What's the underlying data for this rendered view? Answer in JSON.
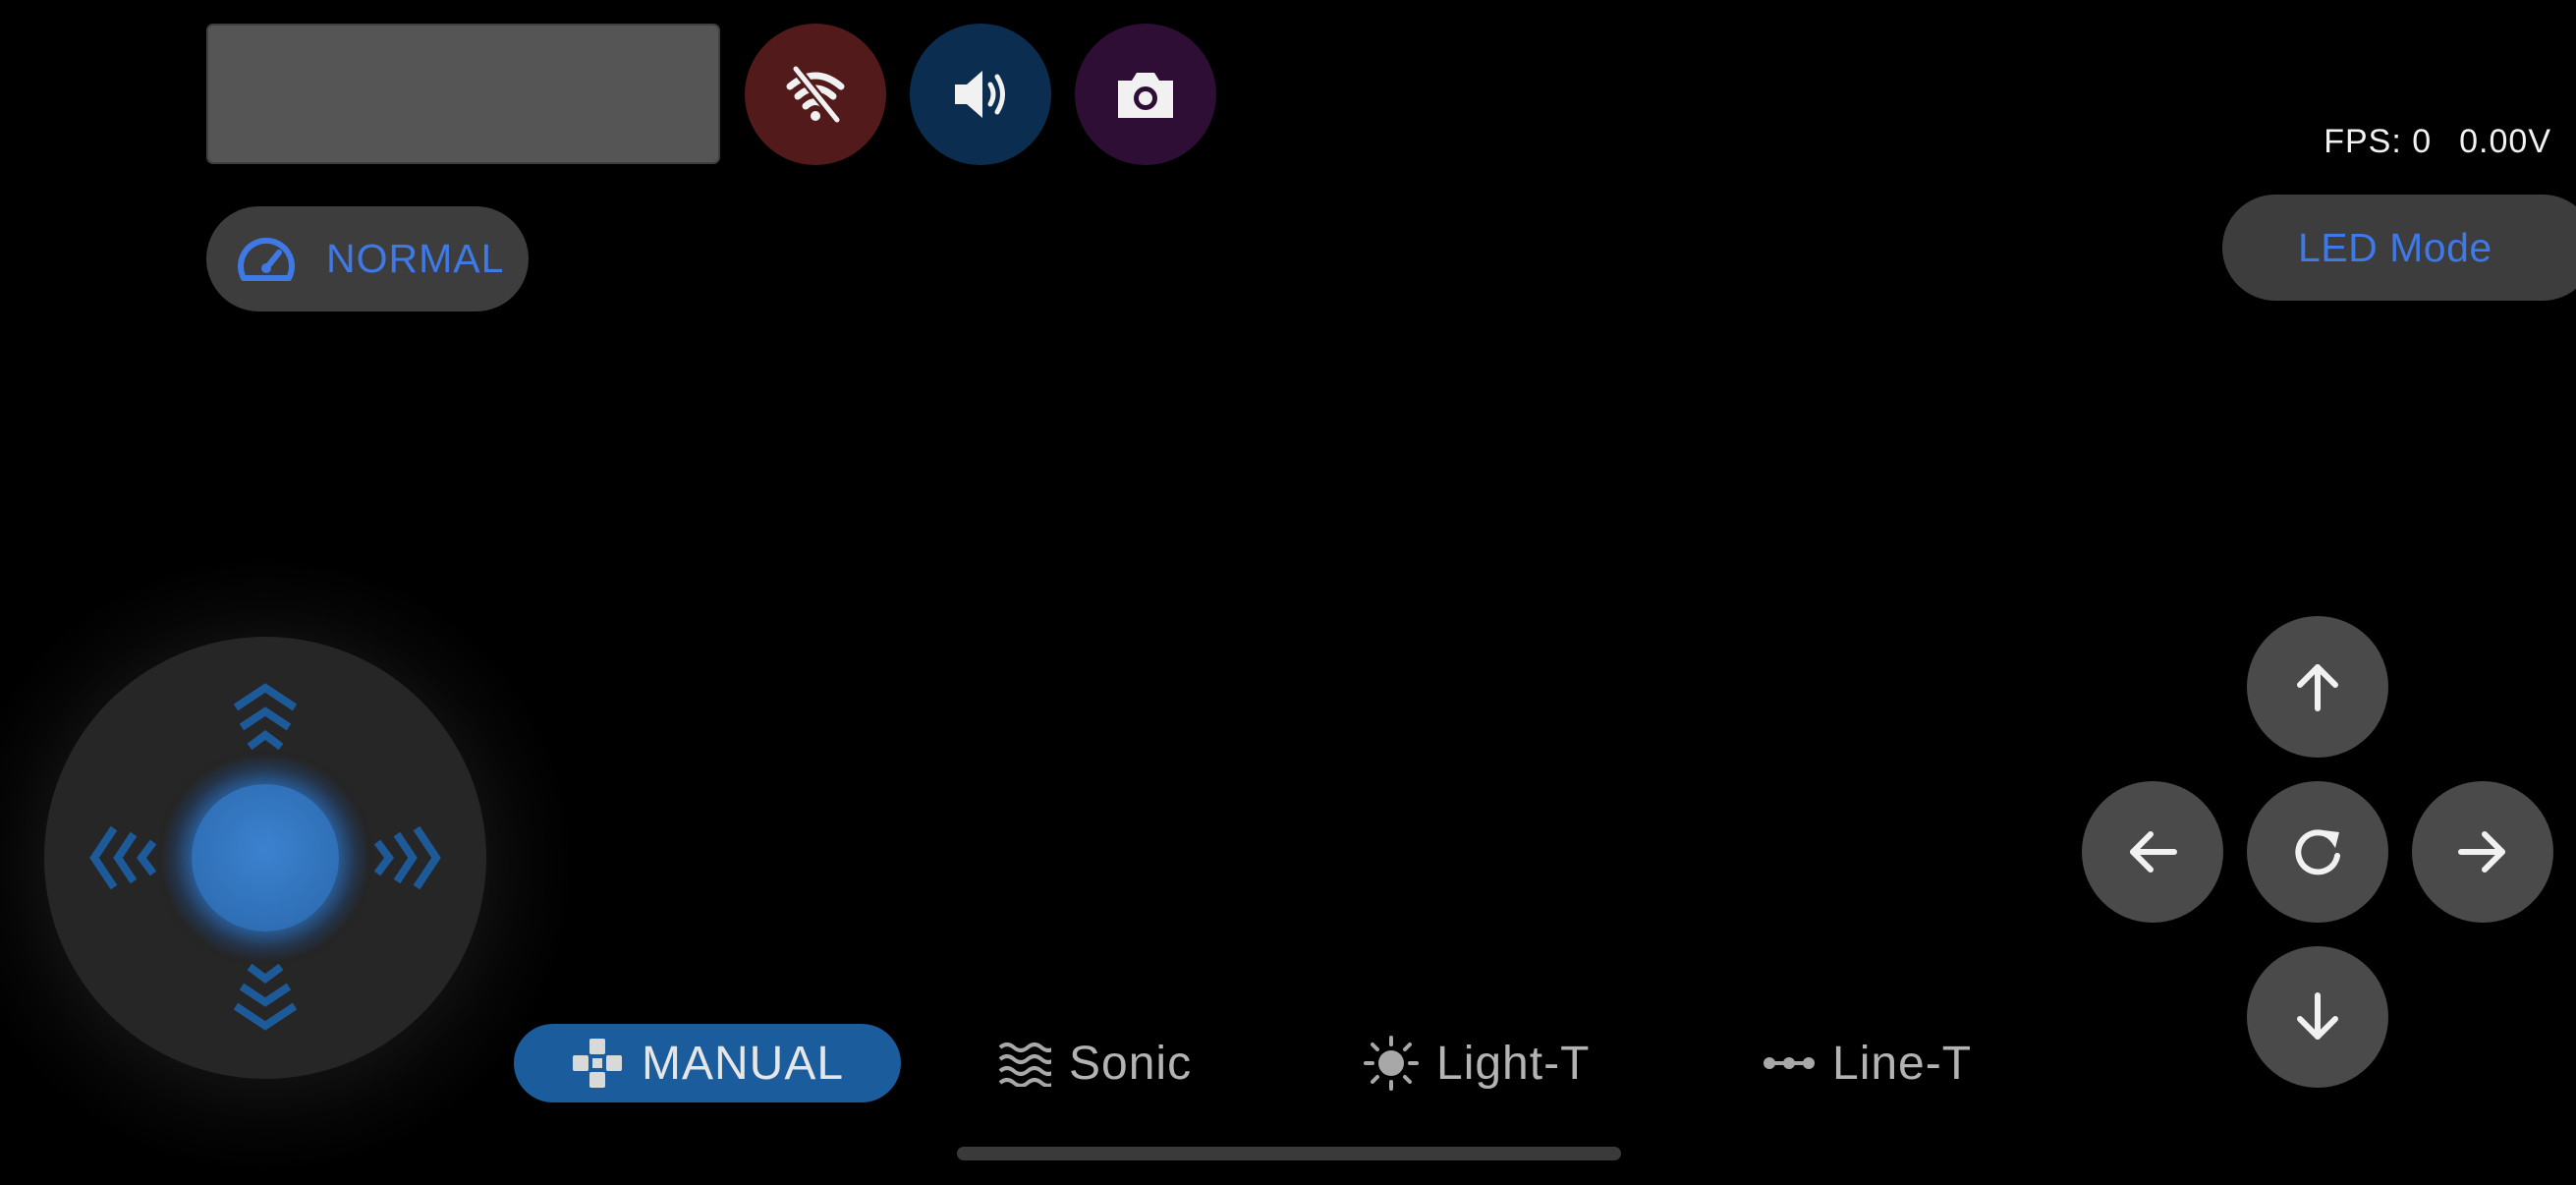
{
  "status": {
    "fps_label": "FPS: 0",
    "voltage": "0.00V"
  },
  "top_controls": {
    "wifi_icon": "wifi-off-icon",
    "sound_icon": "speaker-icon",
    "camera_icon": "camera-icon"
  },
  "speed": {
    "label": "NORMAL",
    "icon": "speedometer-icon"
  },
  "led": {
    "label": "LED Mode"
  },
  "modes": [
    {
      "label": "MANUAL",
      "icon": "gamepad-icon",
      "active": true
    },
    {
      "label": "Sonic",
      "icon": "waves-icon",
      "active": false
    },
    {
      "label": "Light-T",
      "icon": "sun-icon",
      "active": false
    },
    {
      "label": "Line-T",
      "icon": "line-dots-icon",
      "active": false
    }
  ],
  "colors": {
    "accent_blue": "#3f79e6",
    "active_tab": "#1b5c9c",
    "wifi_button": "#521a1a",
    "sound_button": "#0b2e50",
    "camera_button": "#2f0e36",
    "joystick_knob": "#2f6fb6"
  }
}
